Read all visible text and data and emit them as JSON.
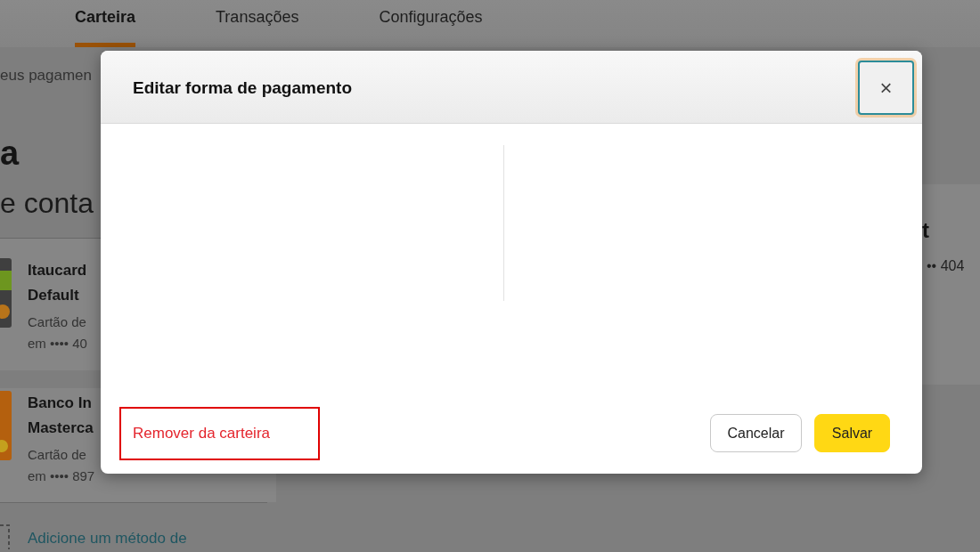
{
  "nav": {
    "tabs": [
      {
        "label": "Carteira",
        "selected": true
      },
      {
        "label": "Transações",
        "selected": false
      },
      {
        "label": "Configurações",
        "selected": false
      }
    ]
  },
  "page": {
    "breadcrumb": "eus pagamen",
    "heading": "a",
    "subheading": "e conta",
    "cards": [
      {
        "kind": "banded",
        "color": "#3f3f3f",
        "title_lines": [
          "Itaucard",
          "Default"
        ],
        "detail_lines": [
          "Cartão de",
          "em •••• 40"
        ]
      },
      {
        "kind": "plain",
        "color": "#b4600e",
        "title_lines": [
          "Banco In",
          "Masterca"
        ],
        "detail_lines": [
          "Cartão de",
          "em •••• 897"
        ]
      }
    ],
    "add_link": "Adicione um método de",
    "side_card": {
      "title": "t",
      "detail": "•• 404"
    }
  },
  "modal": {
    "title": "Editar forma de pagamento",
    "close": {
      "label": "×",
      "focused": true
    },
    "remove": {
      "label": "Remover da carteira",
      "highlighted": true
    },
    "buttons": [
      {
        "label": "Cancelar",
        "kind": "secondary"
      },
      {
        "label": "Salvar",
        "kind": "primary"
      }
    ]
  }
}
